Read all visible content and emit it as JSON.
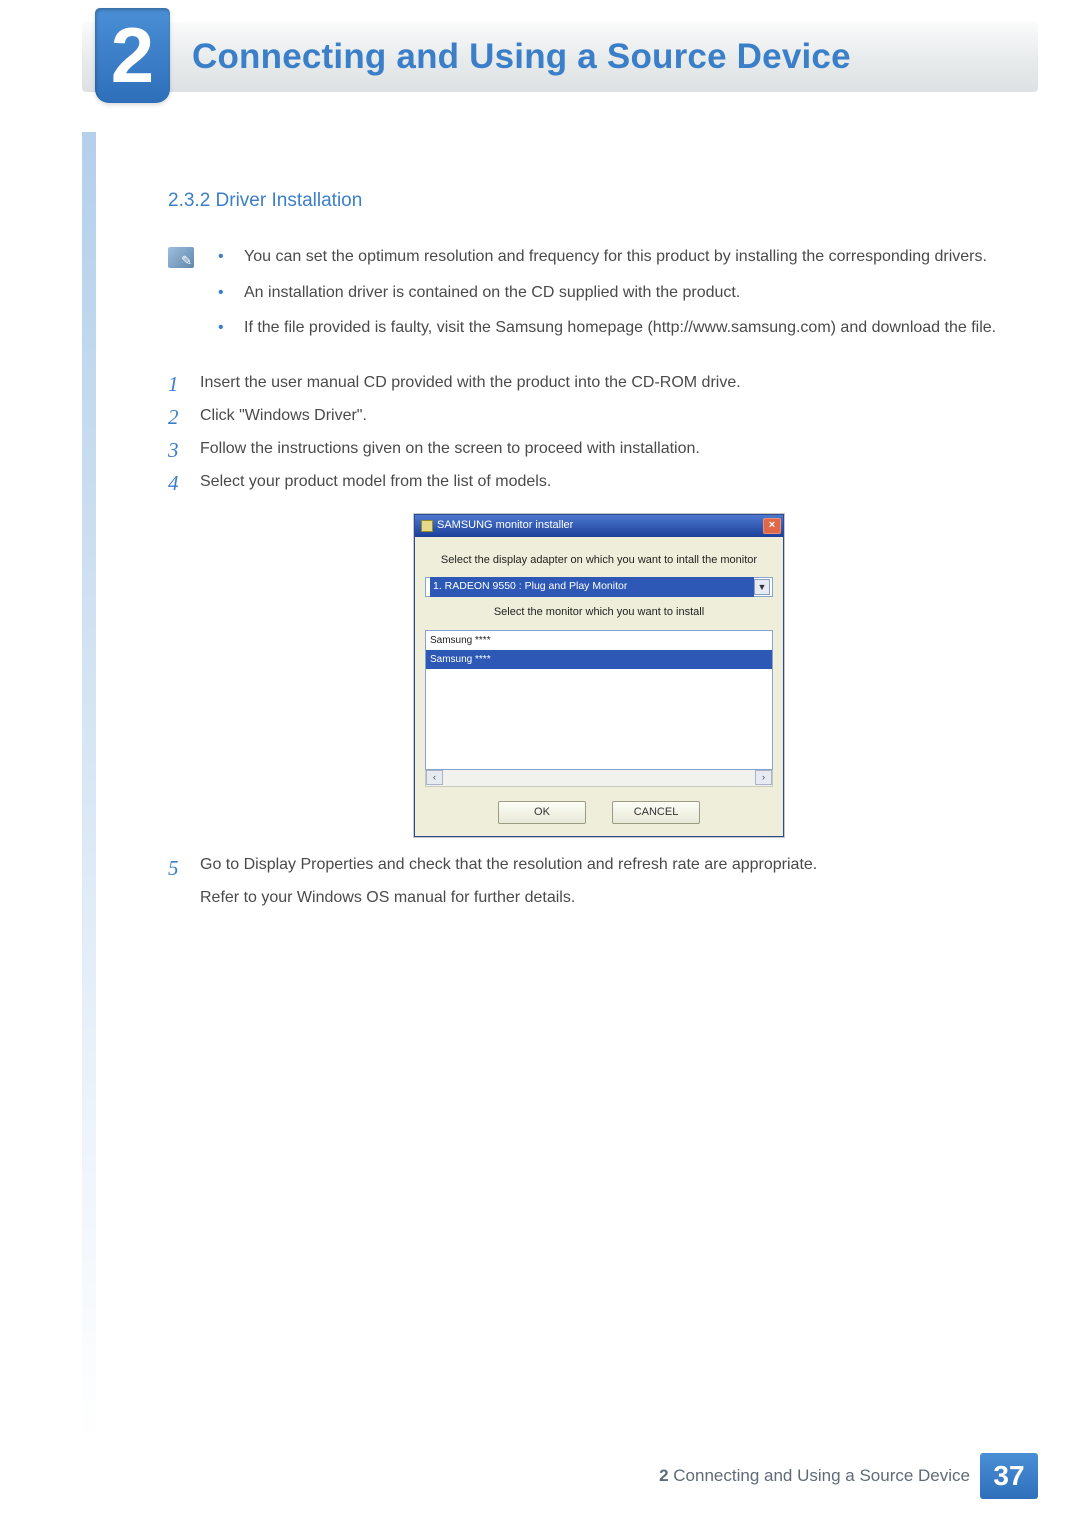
{
  "header": {
    "chapter_number": "2",
    "title": "Connecting and Using a Source Device"
  },
  "section": {
    "number": "2.3.2",
    "title": "Driver Installation",
    "heading": "2.3.2   Driver Installation"
  },
  "notes": [
    "You can set the optimum resolution and frequency for this product by installing the corresponding drivers.",
    "An installation driver is contained on the CD supplied with the product.",
    "If the file provided is faulty, visit the Samsung homepage (http://www.samsung.com) and download the file."
  ],
  "steps": {
    "1": "Insert the user manual CD provided with the product into the CD-ROM drive.",
    "2": "Click \"Windows Driver\".",
    "3": "Follow the instructions given on the screen to proceed with installation.",
    "4": "Select your product model from the list of models.",
    "5a": "Go to Display Properties and check that the resolution and refresh rate are appropriate.",
    "5b": "Refer to your Windows OS manual for further details."
  },
  "dialog": {
    "title": "SAMSUNG monitor installer",
    "label_adapter": "Select the display adapter on which you want to intall the monitor",
    "adapter_selected": "1. RADEON 9550 : Plug and Play Monitor",
    "label_monitor": "Select the monitor which you want to install",
    "list_item_1": "Samsung ****",
    "list_item_2": "Samsung ****",
    "btn_ok": "OK",
    "btn_cancel": "CANCEL"
  },
  "footer": {
    "chapter_number": "2",
    "chapter_title": "Connecting and Using a Source Device",
    "page": "37"
  }
}
